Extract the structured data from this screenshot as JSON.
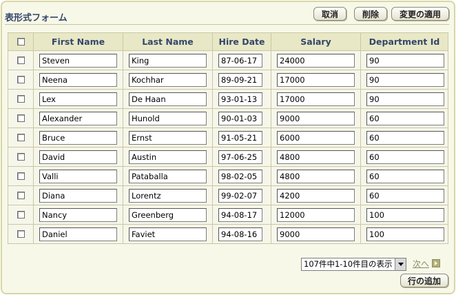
{
  "form": {
    "title": "表形式フォーム",
    "buttons": {
      "cancel": "取消",
      "delete": "削除",
      "apply": "変更の適用",
      "add_row": "行の追加"
    }
  },
  "table": {
    "headers": {
      "first_name": "First Name",
      "last_name": "Last Name",
      "hire_date": "Hire Date",
      "salary": "Salary",
      "department_id": "Department Id"
    },
    "rows": [
      {
        "first_name": "Steven",
        "last_name": "King",
        "hire_date": "87-06-17",
        "salary": "24000",
        "department_id": "90"
      },
      {
        "first_name": "Neena",
        "last_name": "Kochhar",
        "hire_date": "89-09-21",
        "salary": "17000",
        "department_id": "90"
      },
      {
        "first_name": "Lex",
        "last_name": "De Haan",
        "hire_date": "93-01-13",
        "salary": "17000",
        "department_id": "90"
      },
      {
        "first_name": "Alexander",
        "last_name": "Hunold",
        "hire_date": "90-01-03",
        "salary": "9000",
        "department_id": "60"
      },
      {
        "first_name": "Bruce",
        "last_name": "Ernst",
        "hire_date": "91-05-21",
        "salary": "6000",
        "department_id": "60"
      },
      {
        "first_name": "David",
        "last_name": "Austin",
        "hire_date": "97-06-25",
        "salary": "4800",
        "department_id": "60"
      },
      {
        "first_name": "Valli",
        "last_name": "Pataballa",
        "hire_date": "98-02-05",
        "salary": "4800",
        "department_id": "60"
      },
      {
        "first_name": "Diana",
        "last_name": "Lorentz",
        "hire_date": "99-02-07",
        "salary": "4200",
        "department_id": "60"
      },
      {
        "first_name": "Nancy",
        "last_name": "Greenberg",
        "hire_date": "94-08-17",
        "salary": "12000",
        "department_id": "100"
      },
      {
        "first_name": "Daniel",
        "last_name": "Faviet",
        "hire_date": "94-08-16",
        "salary": "9000",
        "department_id": "100"
      }
    ]
  },
  "pagination": {
    "range_select": "107件中1-10件目の表示",
    "next_label": "次へ",
    "next_icon": "arrow-right-icon"
  },
  "colors": {
    "header_text": "#33476a",
    "header_bg": "#e9e8c6",
    "frame_border": "#d8d6a4",
    "frame_bg": "#f8f8e9"
  }
}
